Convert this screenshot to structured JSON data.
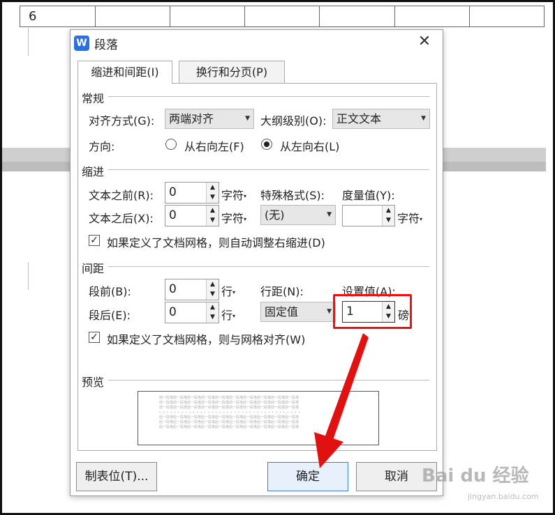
{
  "document": {
    "table_first_cell": "6"
  },
  "dialog": {
    "title": "段落",
    "app_icon_letter": "W",
    "close_glyph": "✕",
    "tabs": [
      {
        "label": "缩进和间距(I)",
        "active": true
      },
      {
        "label": "换行和分页(P)",
        "active": false
      }
    ],
    "general": {
      "section": "常规",
      "alignment_label": "对齐方式(G):",
      "alignment_value": "两端对齐",
      "outline_label": "大纲级别(O):",
      "outline_value": "正文文本",
      "direction_label": "方向:",
      "rtl_label": "从右向左(F)",
      "ltr_label": "从左向右(L)",
      "direction_selected": "ltr"
    },
    "indent": {
      "section": "缩进",
      "before_label": "文本之前(R):",
      "before_value": "0",
      "after_label": "文本之后(X):",
      "after_value": "0",
      "unit": "字符",
      "special_label": "特殊格式(S):",
      "special_value": "(无)",
      "measure_label": "度量值(Y):",
      "measure_value": "",
      "measure_unit": "字符",
      "grid_checkbox_label": "如果定义了文档网格，则自动调整右缩进(D)",
      "grid_checked": true
    },
    "spacing": {
      "section": "间距",
      "before_label": "段前(B):",
      "before_value": "0",
      "after_label": "段后(E):",
      "after_value": "0",
      "unit": "行",
      "line_spacing_label": "行距(N):",
      "line_spacing_value": "固定值",
      "set_value_label": "设置值(A):",
      "set_value": "1",
      "set_value_unit": "磅",
      "grid_checkbox_label": "如果定义了文档网格，则与网格对齐(W)",
      "grid_checked": true
    },
    "preview": {
      "section": "预览",
      "line_before": "前一段落前一段落前一段落前一段落前一段落前一段落前一段落前一段落前一段落前一段落",
      "line_after": "后一段落后一段落后一段落后一段落后一段落后一段落后一段落后一段落后一段落后一段落"
    },
    "buttons": {
      "tabs_label": "制表位(T)...",
      "ok_label": "确定",
      "cancel_label": "取消"
    }
  },
  "watermark": {
    "brand": "Bai du 经验",
    "url": "jingyan.baidu.com"
  },
  "colors": {
    "annotation": "#e11111",
    "primary_border": "#3d7bd6"
  }
}
